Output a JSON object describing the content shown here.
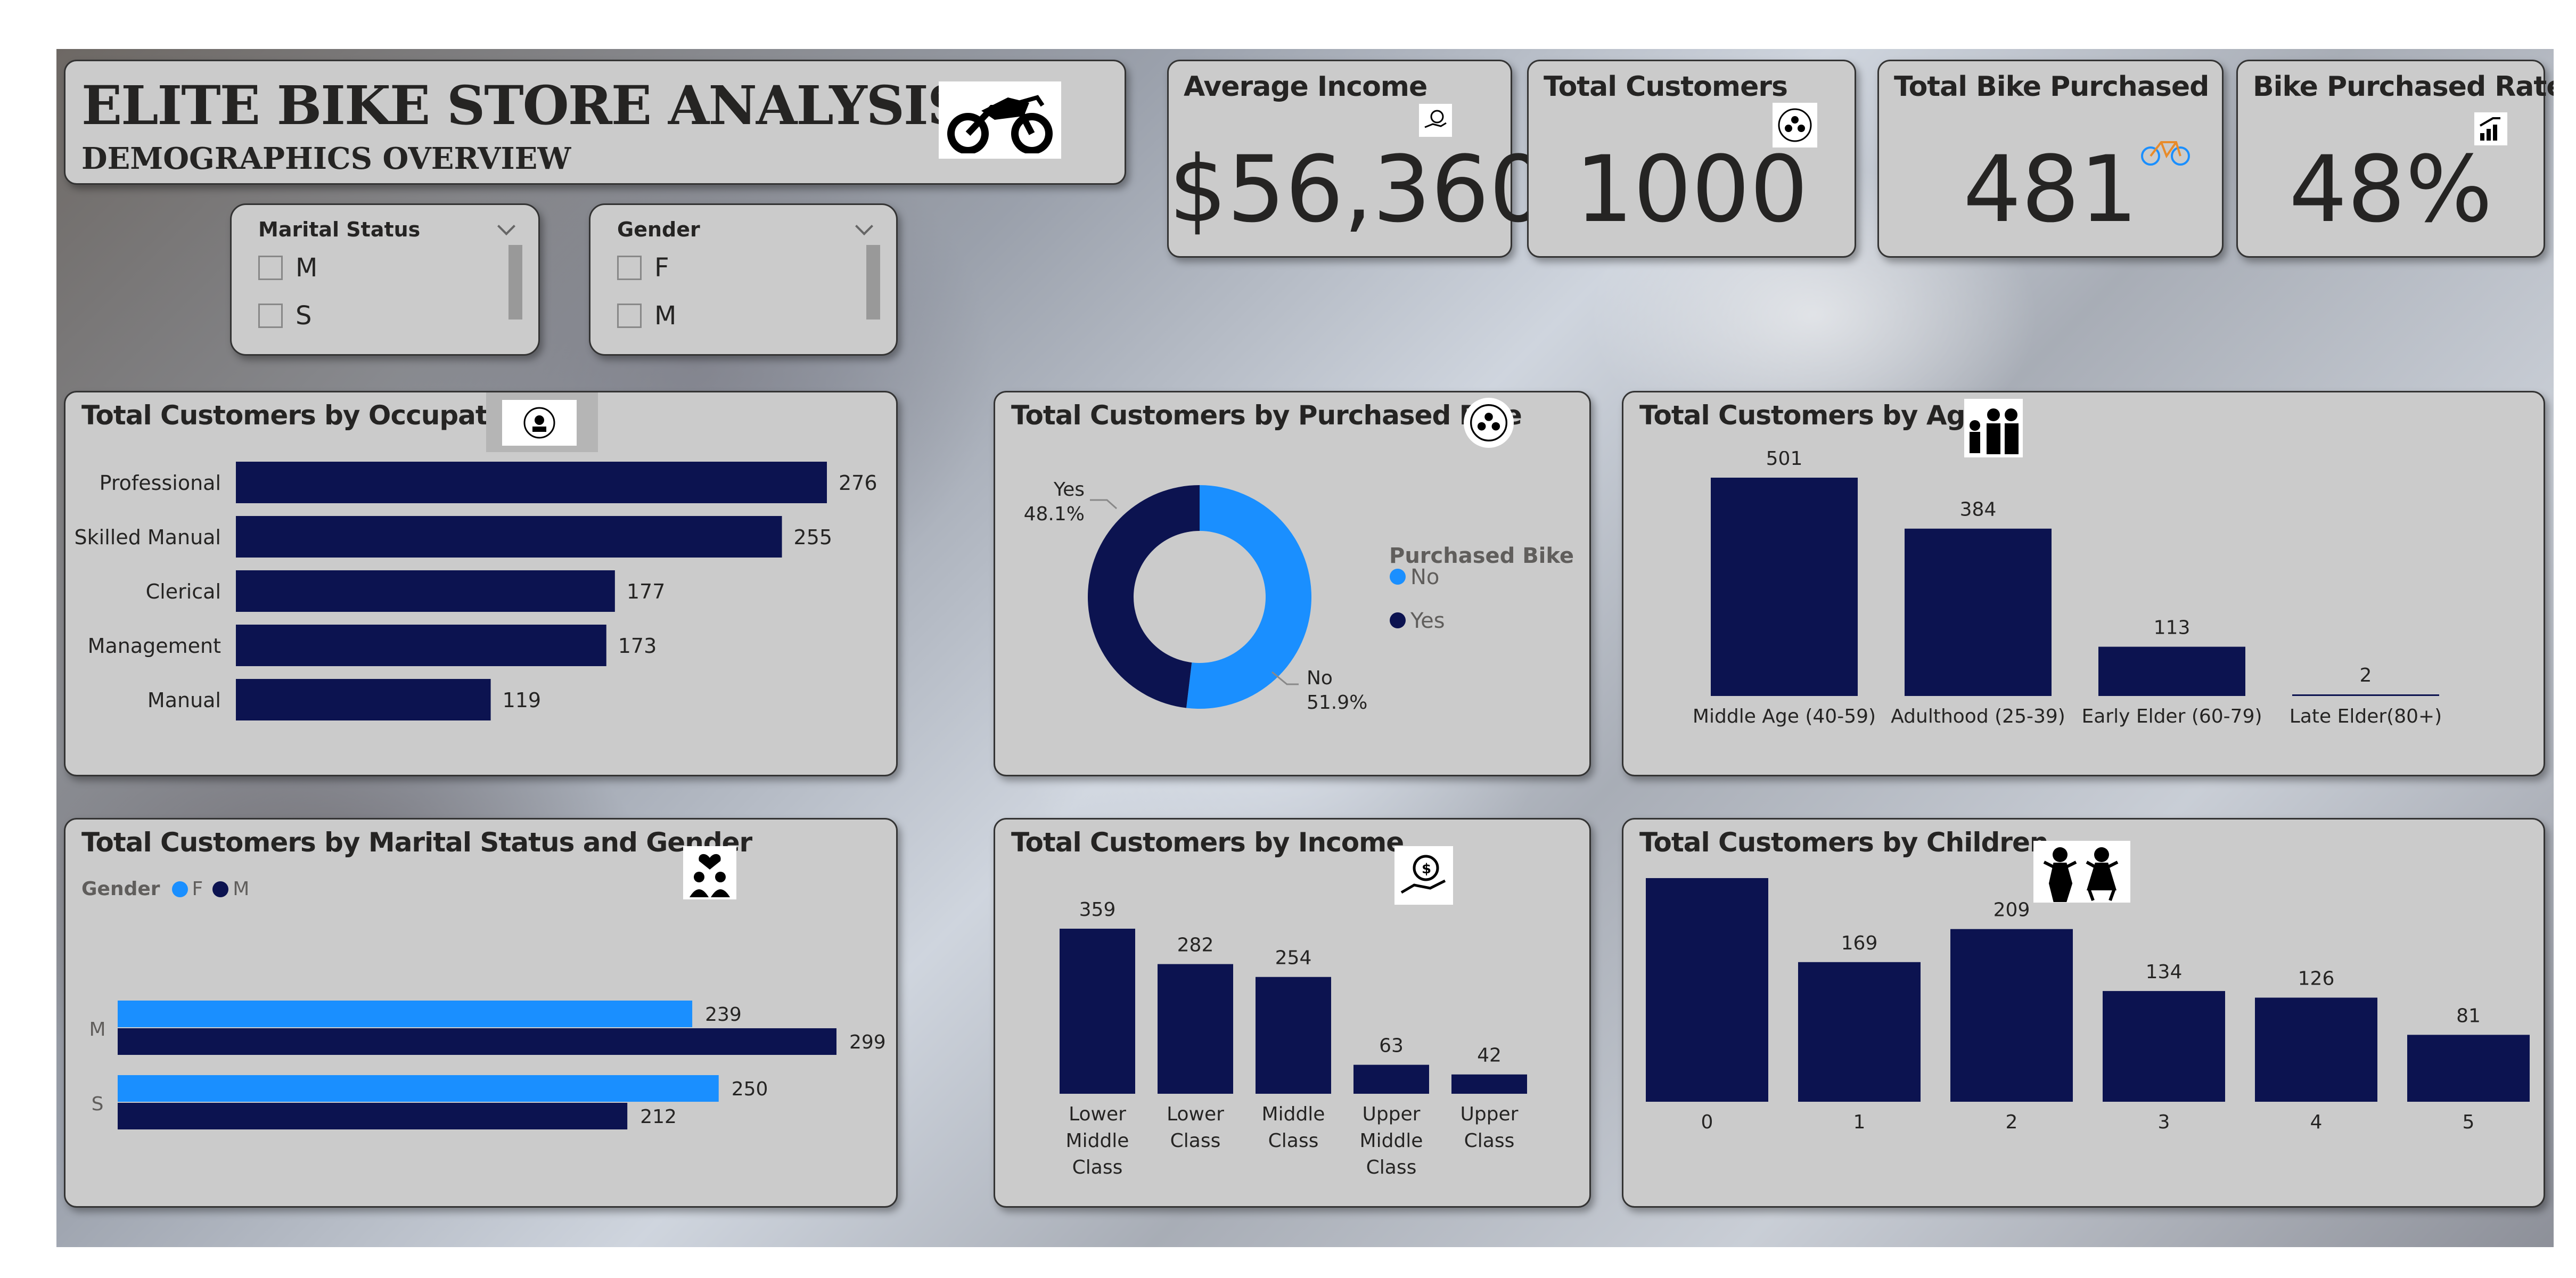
{
  "header": {
    "title": "ELITE BIKE STORE ANALYSIS",
    "subtitle": "DEMOGRAPHICS OVERVIEW",
    "icon": "motorcycle-icon"
  },
  "kpis": [
    {
      "title": "Average Income",
      "value": "$56,360",
      "icon": "money-hand-icon"
    },
    {
      "title": "Total Customers",
      "value": "1000",
      "icon": "people-target-icon"
    },
    {
      "title": "Total Bike Purchased",
      "value": "481",
      "icon": "bicycle-icon"
    },
    {
      "title": "Bike Purchased Rate",
      "value": "48%",
      "icon": "rising-bars-icon"
    }
  ],
  "slicers": {
    "marital": {
      "title": "Marital Status",
      "options": [
        "M",
        "S"
      ]
    },
    "gender": {
      "title": "Gender",
      "options": [
        "F",
        "M"
      ]
    }
  },
  "colors": {
    "dark": "#0c1350",
    "light": "#1a8fff",
    "panel": "#cbcbcb"
  },
  "occupation": {
    "title": "Total Customers by Occupation",
    "chart_data": {
      "type": "bar",
      "orientation": "horizontal",
      "categories": [
        "Professional",
        "Skilled Manual",
        "Clerical",
        "Management",
        "Manual"
      ],
      "values": [
        276,
        255,
        177,
        173,
        119
      ]
    }
  },
  "purchased": {
    "title": "Total Customers by Purchased Bike",
    "legend_title": "Purchased Bike",
    "chart_data": {
      "type": "pie",
      "donut": true,
      "slices": [
        {
          "label": "No",
          "value": 51.9,
          "pct_label": "51.9%"
        },
        {
          "label": "Yes",
          "value": 48.1,
          "pct_label": "48.1%"
        }
      ],
      "legend": [
        "No",
        "Yes"
      ]
    }
  },
  "age": {
    "title": "Total Customers by Age",
    "chart_data": {
      "type": "bar",
      "categories": [
        "Middle Age (40-59)",
        "Adulthood (25-39)",
        "Early Elder (60-79)",
        "Late Elder(80+)"
      ],
      "values": [
        501,
        384,
        113,
        2
      ]
    }
  },
  "marital_gender": {
    "title": "Total Customers by Marital Status and Gender",
    "legend_title": "Gender",
    "chart_data": {
      "type": "bar",
      "orientation": "horizontal",
      "categories": [
        "M",
        "S"
      ],
      "series": [
        {
          "name": "F",
          "values": [
            239,
            250
          ]
        },
        {
          "name": "M",
          "values": [
            299,
            212
          ]
        }
      ]
    }
  },
  "income": {
    "title": "Total Customers by Income",
    "chart_data": {
      "type": "bar",
      "categories": [
        "Lower Middle Class",
        "Lower Class",
        "Middle Class",
        "Upper Middle Class",
        "Upper Class"
      ],
      "category_lines": [
        [
          "Lower",
          "Middle",
          "Class"
        ],
        [
          "Lower",
          "Class"
        ],
        [
          "Middle",
          "Class"
        ],
        [
          "Upper",
          "Middle",
          "Class"
        ],
        [
          "Upper",
          "Class"
        ]
      ],
      "values": [
        359,
        282,
        254,
        63,
        42
      ]
    }
  },
  "children": {
    "title": "Total Customers by Children",
    "chart_data": {
      "type": "bar",
      "categories": [
        "0",
        "1",
        "2",
        "3",
        "4",
        "5"
      ],
      "values": [
        281,
        169,
        209,
        134,
        126,
        81
      ]
    }
  }
}
